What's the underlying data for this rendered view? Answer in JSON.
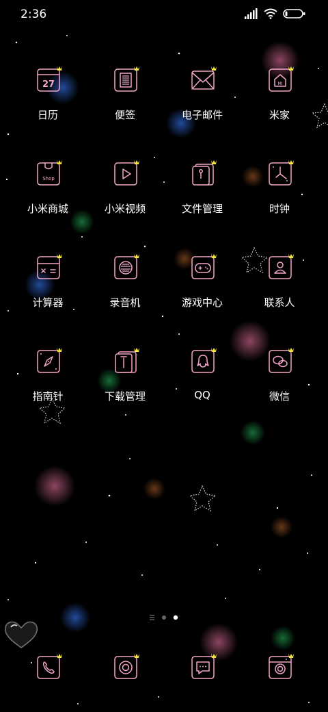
{
  "status": {
    "time": "2:36"
  },
  "apps": [
    {
      "label": "日历",
      "icon": "calendar-icon",
      "badge": "27"
    },
    {
      "label": "便签",
      "icon": "notes-icon"
    },
    {
      "label": "电子邮件",
      "icon": "email-icon"
    },
    {
      "label": "米家",
      "icon": "mi-home-icon",
      "badge": "MI"
    },
    {
      "label": "小米商城",
      "icon": "shop-icon",
      "badge": "Shop"
    },
    {
      "label": "小米视频",
      "icon": "video-icon"
    },
    {
      "label": "文件管理",
      "icon": "file-manager-icon"
    },
    {
      "label": "时钟",
      "icon": "clock-icon"
    },
    {
      "label": "计算器",
      "icon": "calculator-icon"
    },
    {
      "label": "录音机",
      "icon": "recorder-icon"
    },
    {
      "label": "游戏中心",
      "icon": "game-center-icon"
    },
    {
      "label": "联系人",
      "icon": "contacts-icon"
    },
    {
      "label": "指南针",
      "icon": "compass-icon"
    },
    {
      "label": "下载管理",
      "icon": "downloads-icon"
    },
    {
      "label": "QQ",
      "icon": "qq-icon"
    },
    {
      "label": "微信",
      "icon": "wechat-icon"
    }
  ],
  "dock": [
    {
      "icon": "phone-icon"
    },
    {
      "icon": "browser-icon"
    },
    {
      "icon": "messages-icon"
    },
    {
      "icon": "camera-icon"
    }
  ],
  "theme": {
    "icon_color": "#f3a6c8",
    "crown_color": "#f5e83a"
  },
  "page_indicator": {
    "pages": 2,
    "current": 2
  }
}
